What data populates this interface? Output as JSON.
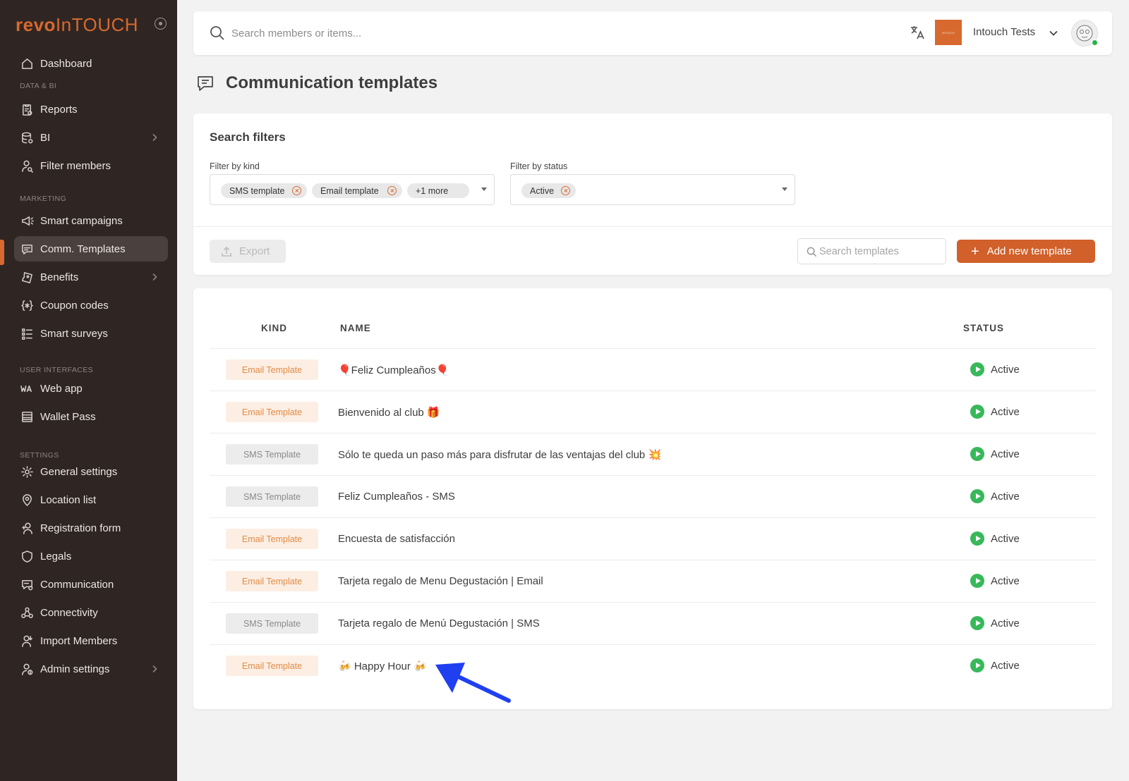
{
  "brand": {
    "name_bold": "revo",
    "name_light": "InTOUCH"
  },
  "sidebar": {
    "sections": {
      "data_bi": "DATA & BI",
      "marketing": "MARKETING",
      "user_interfaces": "USER INTERFACES",
      "settings": "SETTINGS"
    },
    "items": [
      {
        "label": "Dashboard",
        "icon": "home-icon"
      },
      {
        "label": "Reports",
        "icon": "reports-icon"
      },
      {
        "label": "BI",
        "icon": "database-icon",
        "has_submenu": true
      },
      {
        "label": "Filter members",
        "icon": "user-search-icon"
      },
      {
        "label": "Smart campaigns",
        "icon": "megaphone-icon"
      },
      {
        "label": "Comm. Templates",
        "icon": "message-icon",
        "active": true
      },
      {
        "label": "Benefits",
        "icon": "ticket-icon",
        "has_submenu": true
      },
      {
        "label": "Coupon codes",
        "icon": "coupon-icon"
      },
      {
        "label": "Smart surveys",
        "icon": "list-icon"
      },
      {
        "label": "Web app",
        "icon": "pwa-icon"
      },
      {
        "label": "Wallet Pass",
        "icon": "wallet-icon"
      },
      {
        "label": "General settings",
        "icon": "gear-icon"
      },
      {
        "label": "Location list",
        "icon": "location-pin-icon"
      },
      {
        "label": "Registration form",
        "icon": "user-plus-icon"
      },
      {
        "label": "Legals",
        "icon": "shield-icon"
      },
      {
        "label": "Communication",
        "icon": "message-settings-icon"
      },
      {
        "label": "Connectivity",
        "icon": "connectivity-icon"
      },
      {
        "label": "Import Members",
        "icon": "user-import-icon"
      },
      {
        "label": "Admin settings",
        "icon": "admin-icon",
        "has_submenu": true
      }
    ]
  },
  "topbar": {
    "search_placeholder": "Search members or items...",
    "org_logo_text": "INTOUCH",
    "org_name": "Intouch Tests"
  },
  "page": {
    "title": "Communication templates"
  },
  "filters": {
    "title": "Search filters",
    "kind_label": "Filter by kind",
    "kind_chips": [
      "SMS template",
      "Email template",
      "+1 more"
    ],
    "status_label": "Filter by status",
    "status_chips": [
      "Active"
    ],
    "export_label": "Export",
    "search_placeholder": "Search templates",
    "add_label": "Add new template"
  },
  "table": {
    "columns": [
      "KIND",
      "NAME",
      "STATUS"
    ],
    "rows": [
      {
        "kind": "Email Template",
        "type": "email",
        "name": "🎈Feliz Cumpleaños🎈",
        "status": "Active"
      },
      {
        "kind": "Email Template",
        "type": "email",
        "name": "Bienvenido al club 🎁",
        "status": "Active"
      },
      {
        "kind": "SMS Template",
        "type": "sms",
        "name": "Sólo te queda un paso más para disfrutar de las ventajas del club 💥",
        "status": "Active"
      },
      {
        "kind": "SMS Template",
        "type": "sms",
        "name": "Feliz Cumpleaños - SMS",
        "status": "Active"
      },
      {
        "kind": "Email Template",
        "type": "email",
        "name": "Encuesta de satisfacción",
        "status": "Active"
      },
      {
        "kind": "Email Template",
        "type": "email",
        "name": "Tarjeta regalo de Menu Degustación | Email",
        "status": "Active"
      },
      {
        "kind": "SMS Template",
        "type": "sms",
        "name": "Tarjeta regalo de Menú Degustación | SMS",
        "status": "Active"
      },
      {
        "kind": "Email Template",
        "type": "email",
        "name": "🍻 Happy Hour 🍻",
        "status": "Active"
      }
    ]
  },
  "colors": {
    "accent": "#d1602a",
    "sidebar_bg": "#2f2624",
    "status_active": "#38b85b",
    "annotation_arrow": "#1f3ff0"
  }
}
